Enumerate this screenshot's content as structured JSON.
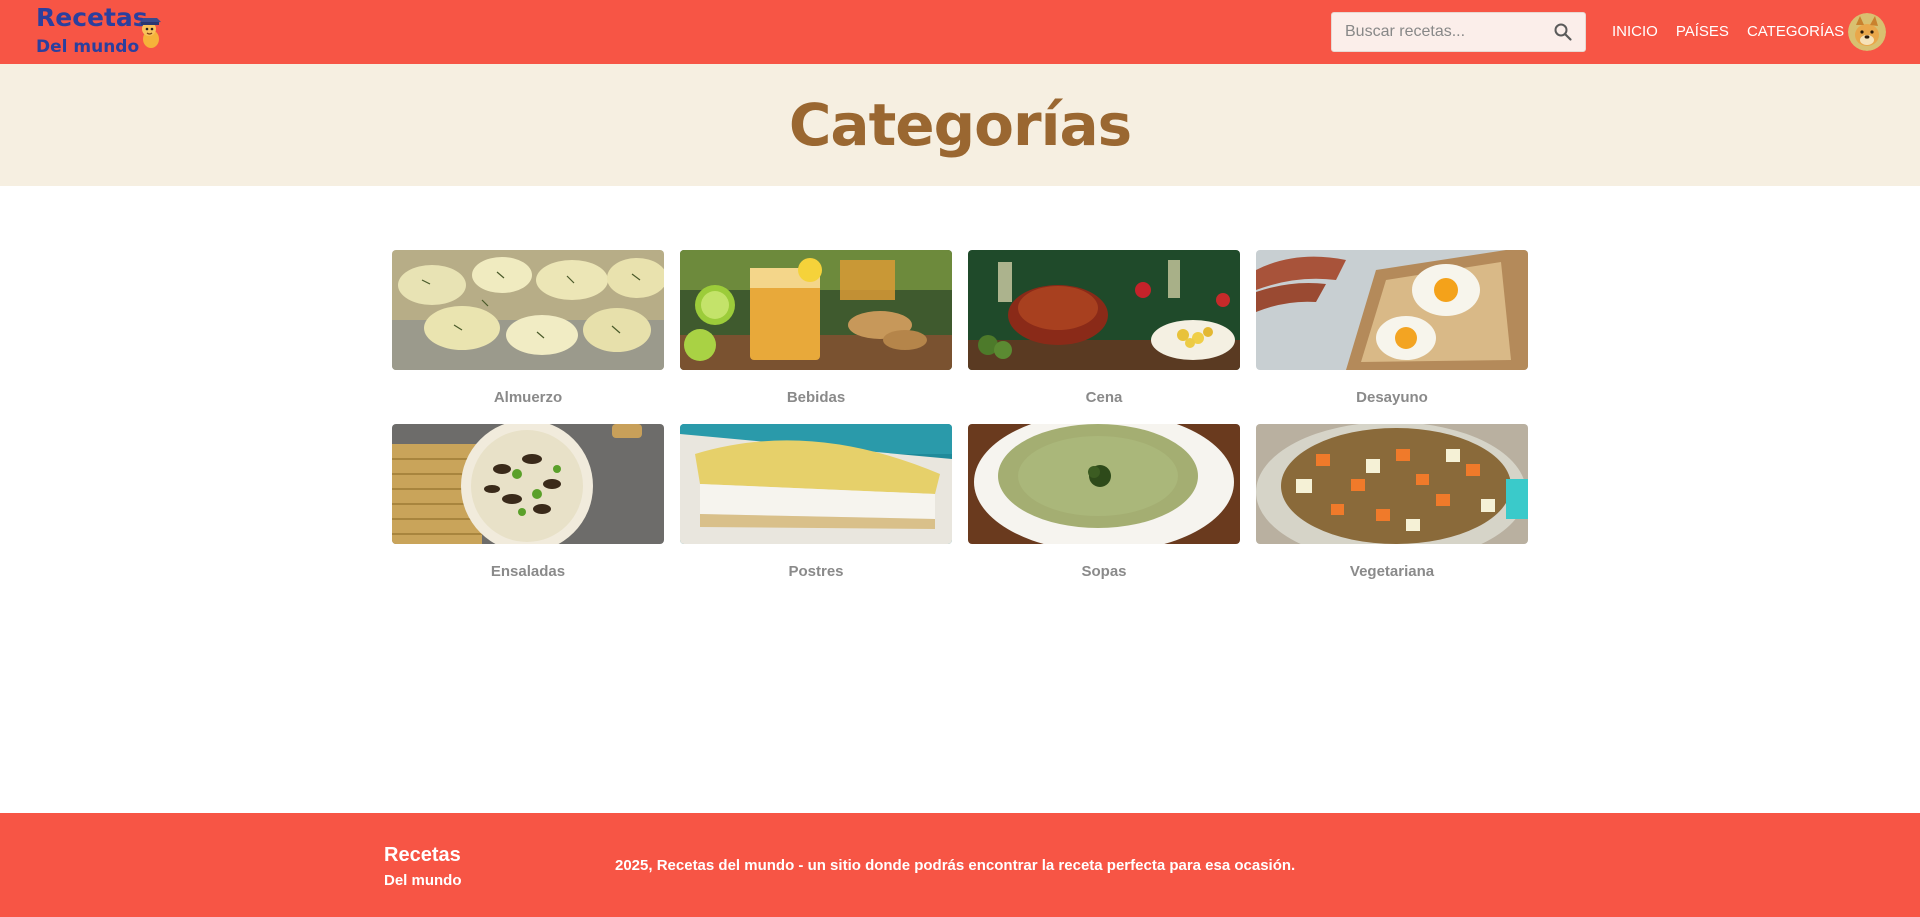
{
  "colors": {
    "header_bg": "#f75545",
    "logo_text": "#2b3f9e",
    "hero_bg": "#f6efe1",
    "hero_title": "#9a6731",
    "card_label": "#8a8a8a",
    "footer_bg": "#f75545"
  },
  "header": {
    "logo_title": "Recetas",
    "logo_subtitle": "Del mundo",
    "logo_mascot_icon": "detective-mascot-icon",
    "search_placeholder": "Buscar recetas...",
    "search_icon": "search-icon",
    "nav": [
      "INICIO",
      "PAÍSES",
      "CATEGORÍAS"
    ],
    "avatar_icon": "dog-avatar-icon"
  },
  "hero": {
    "title": "Categorías"
  },
  "categories": [
    {
      "label": "Almuerzo",
      "image": "potatoes-with-herbs"
    },
    {
      "label": "Bebidas",
      "image": "ginger-lemon-drink"
    },
    {
      "label": "Cena",
      "image": "roast-dinner-table"
    },
    {
      "label": "Desayuno",
      "image": "egg-toast-sausage"
    },
    {
      "label": "Ensaladas",
      "image": "mushroom-salad-bowl"
    },
    {
      "label": "Postres",
      "image": "lemon-cheesecake"
    },
    {
      "label": "Sopas",
      "image": "green-cream-soup"
    },
    {
      "label": "Vegetariana",
      "image": "lentil-vegetable-bowl"
    }
  ],
  "footer": {
    "logo_title": "Recetas",
    "logo_subtitle": "Del mundo",
    "text": "2025, Recetas del mundo - un sitio donde podrás encontrar la receta perfecta para esa ocasión."
  }
}
